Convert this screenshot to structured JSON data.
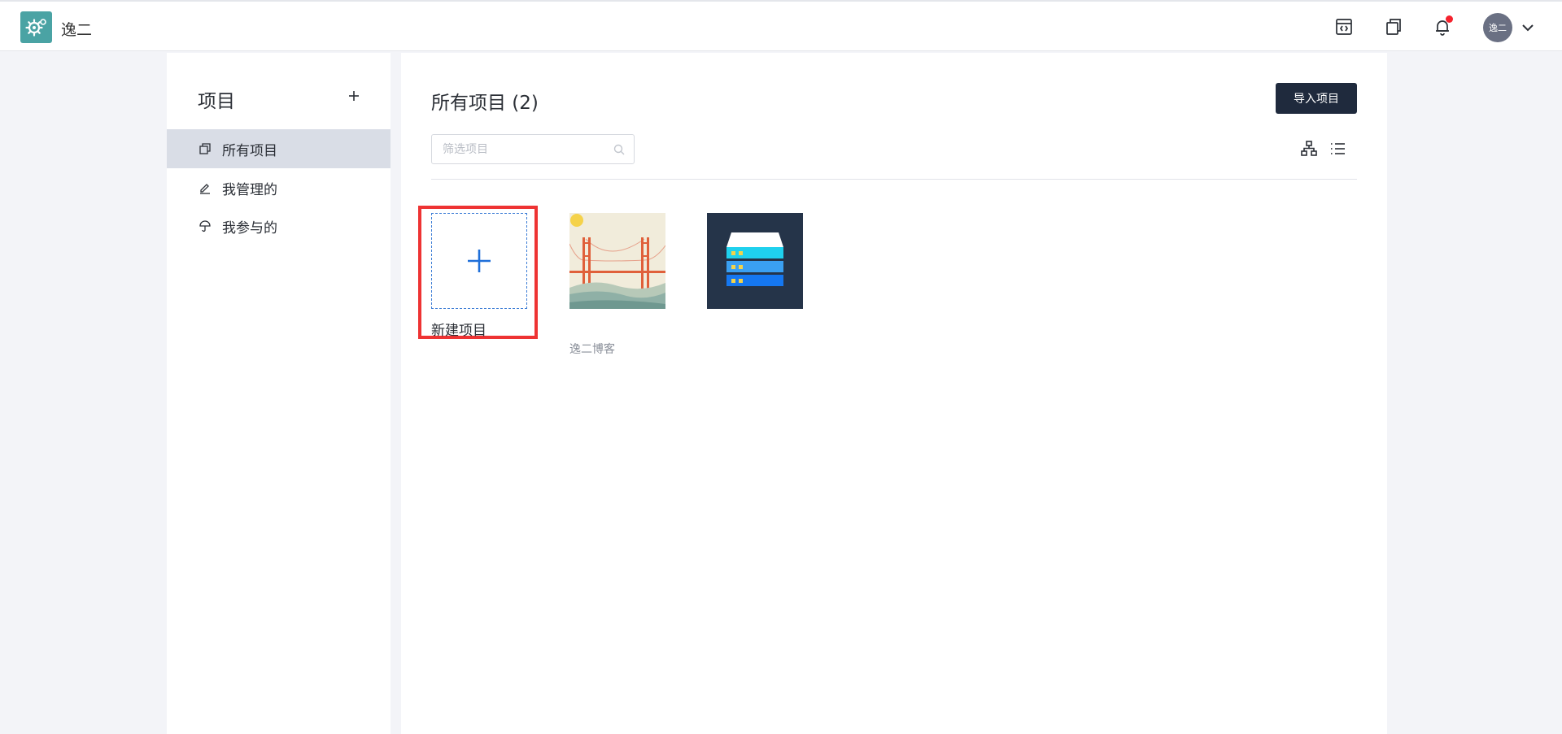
{
  "header": {
    "app_name": "逸二",
    "avatar_text": "逸二"
  },
  "sidebar": {
    "title": "项目",
    "items": [
      {
        "label": "所有项目",
        "active": true
      },
      {
        "label": "我管理的",
        "active": false
      },
      {
        "label": "我参与的",
        "active": false
      }
    ]
  },
  "main": {
    "title": "所有项目 (2)",
    "import_label": "导入项目",
    "filter_placeholder": "筛选项目",
    "new_project_label": "新建项目",
    "projects": [
      {
        "name": "逸二博客",
        "thumbnail": "bridge-illustration"
      },
      {
        "name": "",
        "thumbnail": "server-illustration"
      }
    ]
  },
  "colors": {
    "accent": "#1f2a3d",
    "highlight": "#ee3333",
    "notification": "#f5222d",
    "plus": "#1e6fd9"
  }
}
